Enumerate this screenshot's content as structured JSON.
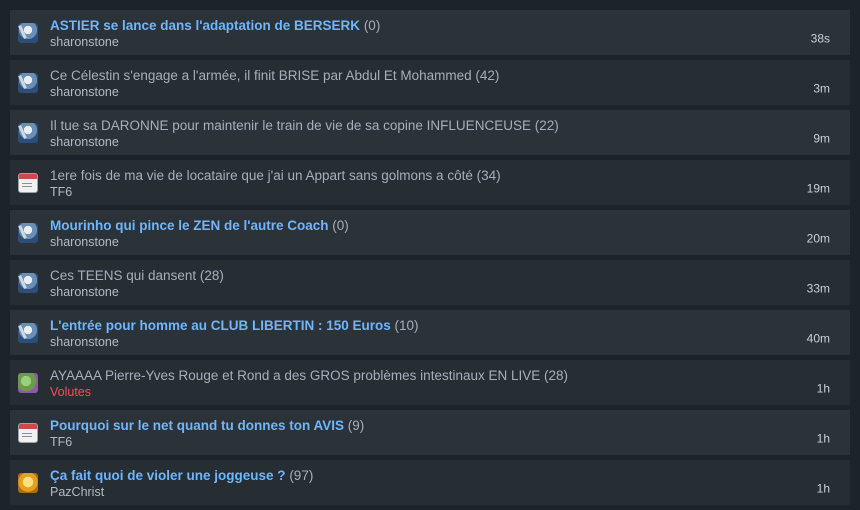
{
  "topics": [
    {
      "title": "ASTIER se lance dans l'adaptation de BERSERK",
      "count": "(0)",
      "author": "sharonstone",
      "time": "38s",
      "unread": true,
      "avatar": "knight-avatar-icon"
    },
    {
      "title": "Ce Célestin s'engage a l'armée, il finit BRISE par Abdul Et Mohammed",
      "count": "(42)",
      "author": "sharonstone",
      "time": "3m",
      "unread": false,
      "avatar": "knight-avatar-icon"
    },
    {
      "title": "Il tue sa DARONNE pour maintenir le train de vie de sa copine INFLUENCEUSE",
      "count": "(22)",
      "author": "sharonstone",
      "time": "9m",
      "unread": false,
      "avatar": "knight-avatar-icon"
    },
    {
      "title": "1ere fois de ma vie de locataire que j'ai un Appart sans golmons a côté",
      "count": "(34)",
      "author": "TF6",
      "time": "19m",
      "unread": false,
      "avatar": "notepad-avatar-icon"
    },
    {
      "title": "Mourinho qui pince le ZEN de l'autre Coach",
      "count": "(0)",
      "author": "sharonstone",
      "time": "20m",
      "unread": true,
      "avatar": "knight-avatar-icon"
    },
    {
      "title": "Ces TEENS qui dansent",
      "count": "(28)",
      "author": "sharonstone",
      "time": "33m",
      "unread": false,
      "avatar": "knight-avatar-icon"
    },
    {
      "title": "L'entrée pour homme au CLUB LIBERTIN : 150 Euros",
      "count": "(10)",
      "author": "sharonstone",
      "time": "40m",
      "unread": true,
      "avatar": "knight-avatar-icon"
    },
    {
      "title": "AYAAAA Pierre-Yves Rouge et Rond a des GROS problèmes intestinaux EN LIVE",
      "count": "(28)",
      "author": "Volutes",
      "time": "1h",
      "unread": false,
      "avatar": "green-avatar-icon",
      "author_color": "#ff4d4d"
    },
    {
      "title": "Pourquoi sur le net quand tu donnes ton AVIS",
      "count": "(9)",
      "author": "TF6",
      "time": "1h",
      "unread": true,
      "avatar": "notepad-avatar-icon"
    },
    {
      "title": "Ça fait quoi de violer une joggeuse ?",
      "count": "(97)",
      "author": "PazChrist",
      "time": "1h",
      "unread": true,
      "avatar": "gold-avatar-icon"
    }
  ],
  "colors": {
    "unread_title": "#6fb6ff",
    "read_title": "#a6b0ba",
    "background": "#1c232b"
  }
}
